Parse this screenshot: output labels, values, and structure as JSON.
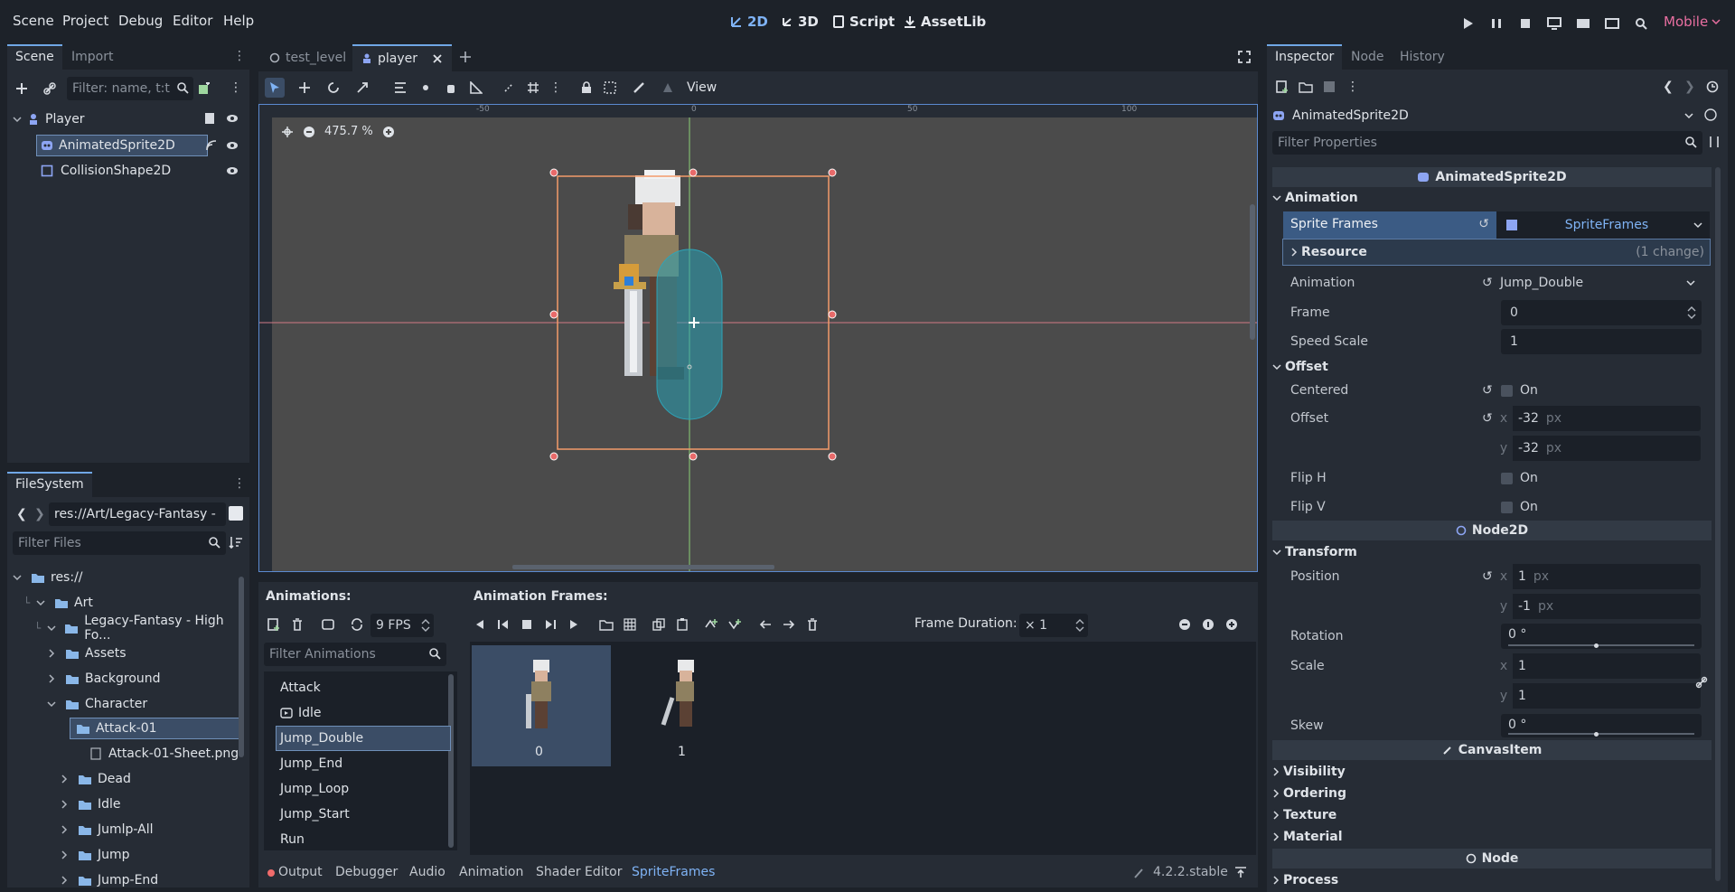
{
  "menu": {
    "scene": "Scene",
    "project": "Project",
    "debug": "Debug",
    "editor": "Editor",
    "help": "Help"
  },
  "modes": {
    "d2": "2D",
    "d3": "3D",
    "script": "Script",
    "assetlib": "AssetLib"
  },
  "renderer": "Mobile",
  "scene_dock": {
    "tabs": {
      "scene": "Scene",
      "import": "Import"
    },
    "filter_placeholder": "Filter: name, t:t",
    "nodes": {
      "player": "Player",
      "sprite": "AnimatedSprite2D",
      "collision": "CollisionShape2D"
    }
  },
  "filesystem": {
    "tab": "FileSystem",
    "path": "res://Art/Legacy-Fantasy -",
    "filter_placeholder": "Filter Files",
    "items": {
      "res": "res://",
      "art": "Art",
      "legacy": "Legacy-Fantasy - High Fo...",
      "assets": "Assets",
      "background": "Background",
      "character": "Character",
      "attack01": "Attack-01",
      "sheet": "Attack-01-Sheet.png",
      "dead": "Dead",
      "idle": "Idle",
      "jumlp_all": "Jumlp-All",
      "jump": "Jump",
      "jump_end": "Jump-End"
    }
  },
  "editor_tabs": {
    "test_level": "test_level",
    "player": "player"
  },
  "viewport": {
    "view": "View",
    "zoom": "475.7 %",
    "ruler": {
      "m50": "-50",
      "z": "0",
      "p50": "50",
      "p100": "100"
    }
  },
  "sprite_frames": {
    "animations_title": "Animations:",
    "frames_title": "Animation Frames:",
    "fps": "9 FPS",
    "filter_placeholder": "Filter Animations",
    "frame_duration_label": "Frame Duration:",
    "frame_duration": "× 1",
    "animations": {
      "a1": "Attack",
      "a2": "Idle",
      "a3": "Jump_Double",
      "a4": "Jump_End",
      "a5": "Jump_Loop",
      "a6": "Jump_Start",
      "a7": "Run"
    },
    "frames": {
      "f0": "0",
      "f1": "1"
    }
  },
  "bottom_panel": {
    "tabs": {
      "output": "Output",
      "debugger": "Debugger",
      "audio": "Audio",
      "animation": "Animation",
      "shader": "Shader Editor",
      "spriteframes": "SpriteFrames"
    },
    "version": "4.2.2.stable"
  },
  "inspector": {
    "tabs": {
      "inspector": "Inspector",
      "node": "Node",
      "history": "History"
    },
    "node_type": "AnimatedSprite2D",
    "filter_placeholder": "Filter Properties",
    "class_header": "AnimatedSprite2D",
    "groups": {
      "animation": "Animation",
      "offset": "Offset",
      "transform": "Transform"
    },
    "props": {
      "sprite_frames": "Sprite Frames",
      "sprite_frames_val": "SpriteFrames",
      "resource": "Resource",
      "resource_change": "(1 change)",
      "animation": "Animation",
      "animation_val": "Jump_Double",
      "frame": "Frame",
      "frame_val": "0",
      "speed_scale": "Speed Scale",
      "speed_scale_val": "1",
      "centered": "Centered",
      "on": "On",
      "offset": "Offset",
      "offset_x": "-32",
      "offset_y": "-32",
      "px": "px",
      "flip_h": "Flip H",
      "flip_v": "Flip V",
      "position": "Position",
      "pos_x": "1",
      "pos_y": "-1",
      "rotation": "Rotation",
      "rotation_val": "0 °",
      "scale": "Scale",
      "scale_x": "1",
      "scale_y": "1",
      "skew": "Skew",
      "skew_val": "0 °",
      "x": "x",
      "y": "y"
    },
    "node2d": "Node2D",
    "canvas_item": "CanvasItem",
    "canvas_groups": {
      "visibility": "Visibility",
      "ordering": "Ordering",
      "texture": "Texture",
      "material": "Material"
    },
    "node": "Node",
    "process": "Process"
  }
}
